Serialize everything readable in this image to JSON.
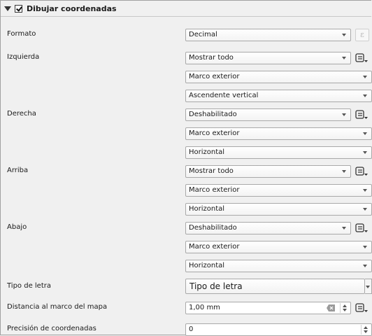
{
  "group": {
    "title": "Dibujar coordenadas",
    "checked": true
  },
  "fields": {
    "formato": {
      "label": "Formato",
      "value": "Decimal",
      "expr_glyph": "ε"
    },
    "izquierda": {
      "label": "Izquierda",
      "display": "Mostrar todo",
      "position": "Marco exterior",
      "direction": "Ascendente vertical"
    },
    "derecha": {
      "label": "Derecha",
      "display": "Deshabilitado",
      "position": "Marco exterior",
      "direction": "Horizontal"
    },
    "arriba": {
      "label": "Arriba",
      "display": "Mostrar todo",
      "position": "Marco exterior",
      "direction": "Horizontal"
    },
    "abajo": {
      "label": "Abajo",
      "display": "Deshabilitado",
      "position": "Marco exterior",
      "direction": "Horizontal"
    },
    "tipo_letra": {
      "label": "Tipo de letra",
      "button": "Tipo de letra"
    },
    "distancia": {
      "label": "Distancia al marco del mapa",
      "value": "1,00 mm"
    },
    "precision": {
      "label": "Precisión de coordenadas",
      "value": "0"
    }
  },
  "icons": {
    "collapse": "chevron-down-icon",
    "expression": "data-defined-override-icon",
    "clear": "clear-field-icon"
  }
}
